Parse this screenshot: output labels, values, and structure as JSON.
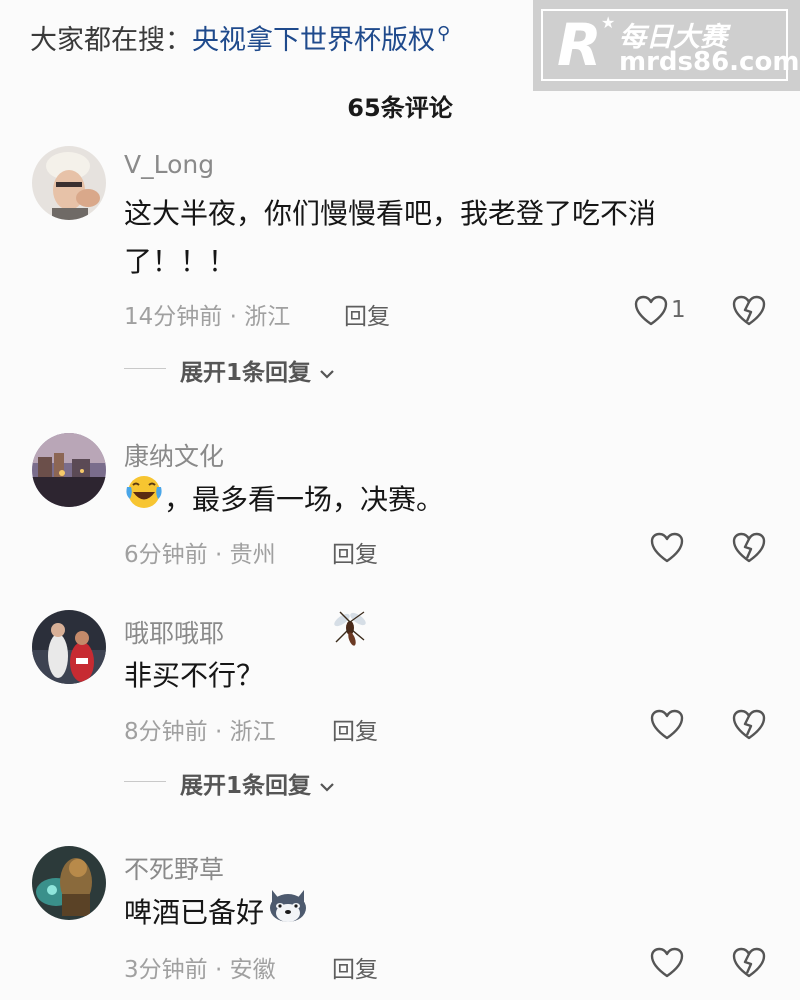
{
  "search_hint": {
    "prefix": "大家都在搜：",
    "term": "央视拿下世界杯版权",
    "icon": "search-icon"
  },
  "watermark": {
    "logo_letter": "R",
    "name": "每日大赛",
    "url": "mrds86.com"
  },
  "comment_count_title": "65条评论",
  "comments": [
    {
      "username": "V_Long",
      "text_line1": "这大半夜，你们慢慢看吧，我老登了吃不消",
      "text_line2": "了！！！",
      "time": "14分钟前",
      "location": "浙江",
      "reply_label": "回复",
      "like_count": "1",
      "expand_label": "展开1条回复"
    },
    {
      "username": "康纳文化",
      "emoji": "laughing-tears-emoji",
      "text": "，最多看一场，决赛。",
      "time": "6分钟前",
      "location": "贵州",
      "reply_label": "回复"
    },
    {
      "username": "哦耶哦耶",
      "badge": "mosquito-icon",
      "text": "非买不行？",
      "time": "8分钟前",
      "location": "浙江",
      "reply_label": "回复",
      "expand_label": "展开1条回复"
    },
    {
      "username": "不死野草",
      "text": "啤酒已备好",
      "emoji": "husky-emoji",
      "time": "3分钟前",
      "location": "安徽",
      "reply_label": "回复"
    }
  ],
  "meta_separator": " · "
}
